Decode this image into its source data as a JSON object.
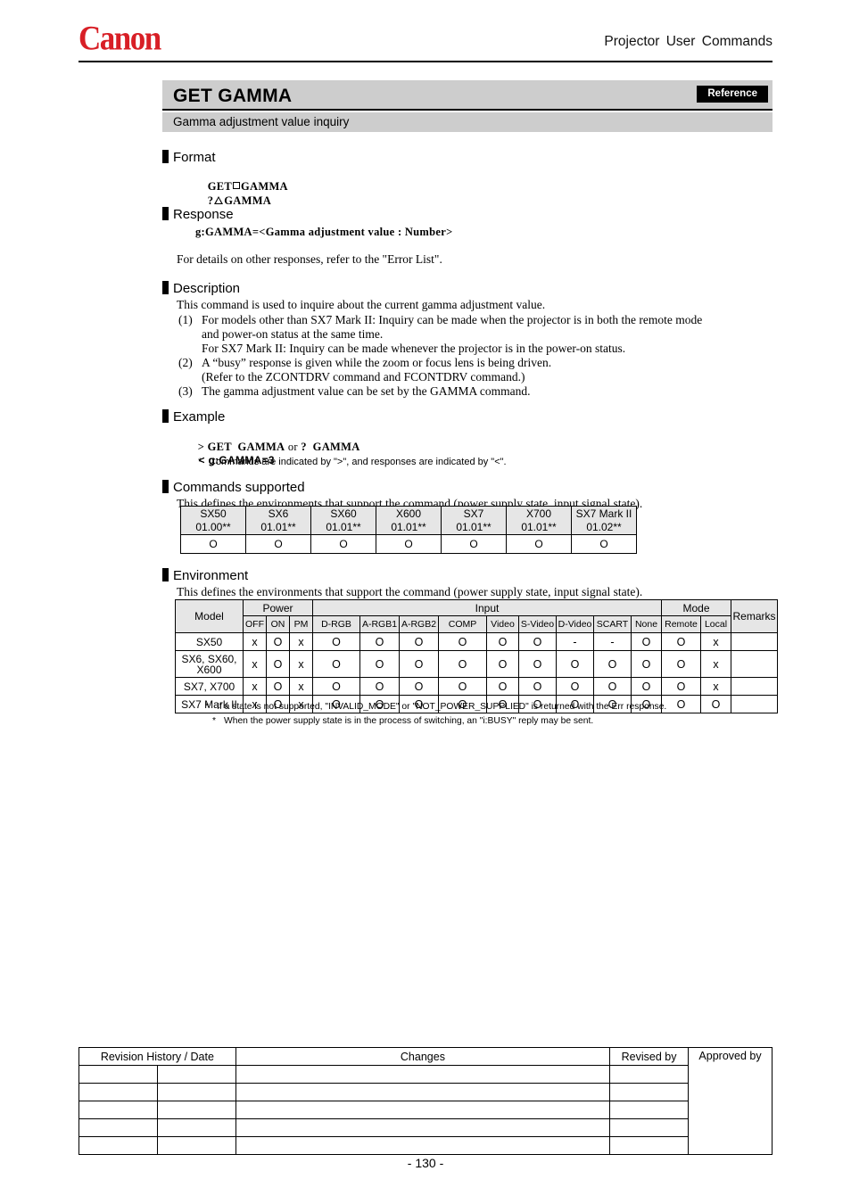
{
  "header": {
    "logo_text": "Canon",
    "document_title": "Projector  User  Commands"
  },
  "command": {
    "title": "GET GAMMA",
    "badge": "Reference",
    "subtitle": "Gamma adjustment value inquiry"
  },
  "sections": {
    "format": {
      "label": "Format",
      "lines": [
        {
          "pre": "GET",
          "symbol": "square",
          "post": "GAMMA"
        },
        {
          "pre": "?",
          "symbol": "triangle",
          "post": "GAMMA"
        }
      ]
    },
    "response": {
      "label": "Response",
      "code": "g:GAMMA=<Gamma adjustment value : Number>",
      "note": "For details on other responses, refer to the \"Error List\"."
    },
    "description": {
      "label": "Description",
      "intro": "This command is used to inquire about the current gamma adjustment value.",
      "items": [
        {
          "num": "(1)",
          "lines": [
            "For models other than SX7 Mark II: Inquiry can be made when the projector is in both the remote mode",
            "and power-on status at the same time.",
            "For SX7 Mark II: Inquiry can be made whenever the projector is in the power-on status."
          ]
        },
        {
          "num": "(2)",
          "lines": [
            "A “busy” response is given while the zoom or focus lens is being driven.",
            "(Refer to the ZCONTDRV command and FCONTDRV command.)"
          ]
        },
        {
          "num": "(3)",
          "lines": [
            "The gamma adjustment value can be set by the GAMMA command."
          ]
        }
      ]
    },
    "example": {
      "label": "Example",
      "command_line": "> GET GAMMA or ? GAMMA",
      "command_prompt": ">",
      "command_body": "GET  GAMMA",
      "command_or": "or",
      "command_alt": "?  GAMMA",
      "response_prompt": "<",
      "response_body": "g:GAMMA=3",
      "note": "Commands are indicated by \">\", and responses are indicated by \"<\".",
      "note_asterisk": "*"
    },
    "commands_supported": {
      "label": "Commands supported",
      "intro": "This defines the environments that support the command (power supply state, input signal state)."
    },
    "environment": {
      "label": "Environment",
      "intro": "This defines the environments that support the command (power supply state, input signal state)."
    }
  },
  "commands_table": {
    "models": [
      {
        "name": "SX50",
        "version": "01.00**",
        "supported": "O"
      },
      {
        "name": "SX6",
        "version": "01.01**",
        "supported": "O"
      },
      {
        "name": "SX60",
        "version": "01.01**",
        "supported": "O"
      },
      {
        "name": "X600",
        "version": "01.01**",
        "supported": "O"
      },
      {
        "name": "SX7",
        "version": "01.01**",
        "supported": "O"
      },
      {
        "name": "X700",
        "version": "01.01**",
        "supported": "O"
      },
      {
        "name": "SX7 Mark II",
        "version": "01.02**",
        "supported": "O"
      }
    ]
  },
  "environment_table": {
    "group_headers": {
      "model": "Model",
      "power": "Power",
      "input": "Input",
      "mode": "Mode",
      "remarks": "Remarks"
    },
    "sub_headers": {
      "power": [
        "OFF",
        "ON",
        "PM"
      ],
      "input": [
        "D-RGB",
        "A-RGB1",
        "A-RGB2",
        "COMP",
        "Video",
        "S-Video",
        "D-Video",
        "SCART",
        "None"
      ],
      "mode": [
        "Remote",
        "Local"
      ]
    },
    "rows": [
      {
        "model": "SX50",
        "model_line2": "",
        "power": [
          "x",
          "O",
          "x"
        ],
        "input": [
          "O",
          "O",
          "O",
          "O",
          "O",
          "O",
          "-",
          "-",
          "O"
        ],
        "mode": [
          "O",
          "x"
        ],
        "remarks": ""
      },
      {
        "model": "SX6, SX60,",
        "model_line2": "X600",
        "power": [
          "x",
          "O",
          "x"
        ],
        "input": [
          "O",
          "O",
          "O",
          "O",
          "O",
          "O",
          "O",
          "O",
          "O"
        ],
        "mode": [
          "O",
          "x"
        ],
        "remarks": ""
      },
      {
        "model": "SX7, X700",
        "model_line2": "",
        "power": [
          "x",
          "O",
          "x"
        ],
        "input": [
          "O",
          "O",
          "O",
          "O",
          "O",
          "O",
          "O",
          "O",
          "O"
        ],
        "mode": [
          "O",
          "x"
        ],
        "remarks": ""
      },
      {
        "model": "SX7 Mark II",
        "model_line2": "",
        "power": [
          "x",
          "O",
          "x"
        ],
        "input": [
          "O",
          "O",
          "O",
          "O",
          "O",
          "O",
          "O",
          "O",
          "O"
        ],
        "mode": [
          "O",
          "O"
        ],
        "remarks": ""
      }
    ],
    "footnotes": [
      {
        "marker": "*",
        "text": "If a state is not supported, \"INVALID_MODE\" or \"NOT_POWER_SUPPLIED\" is returned with the Err response."
      },
      {
        "marker": "*",
        "text": "When the power supply state is in the process of switching, an \"i:BUSY\" reply may be sent."
      }
    ]
  },
  "revision_table": {
    "headers": {
      "revision": "Revision History / Date",
      "changes": "Changes",
      "revised_by": "Revised by",
      "approved_by": "Approved by"
    },
    "rows": [
      {
        "date1": "",
        "date2": "",
        "changes": "",
        "revised_by": ""
      },
      {
        "date1": "",
        "date2": "",
        "changes": "",
        "revised_by": ""
      },
      {
        "date1": "",
        "date2": "",
        "changes": "",
        "revised_by": ""
      },
      {
        "date1": "",
        "date2": "",
        "changes": "",
        "revised_by": ""
      },
      {
        "date1": "",
        "date2": "",
        "changes": "",
        "revised_by": ""
      }
    ],
    "approved_by_value": ""
  },
  "footer": {
    "page_number": "- 130 -"
  },
  "colors": {
    "brand_red": "#d81f26",
    "band_gray": "#cdcdcd",
    "table_header_gray": "#e6e6e6",
    "badge_bg": "#000000"
  }
}
